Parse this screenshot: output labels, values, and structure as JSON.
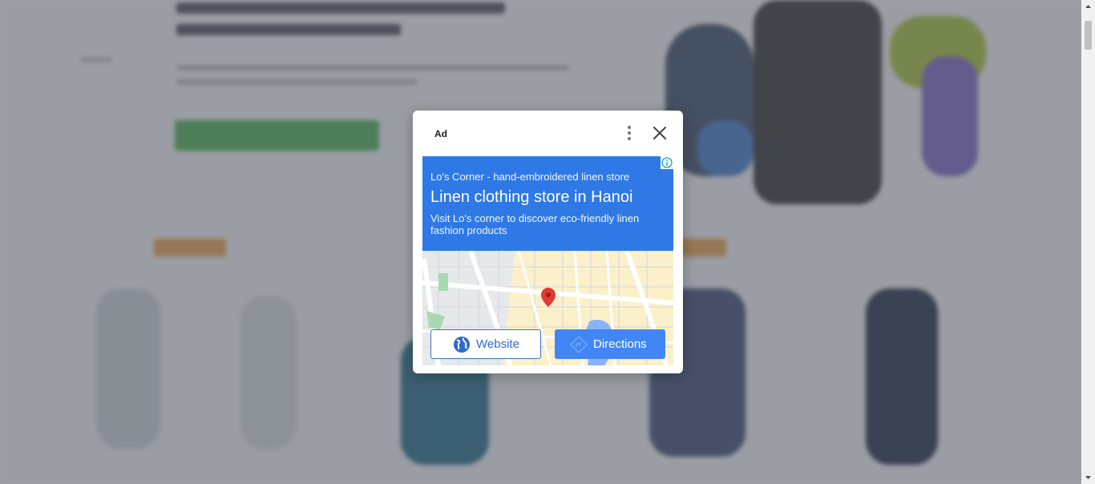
{
  "ad_dialog": {
    "ad_label": "Ad",
    "advertiser": "Lo's Corner - hand-embroidered linen store",
    "headline": "Linen clothing store in Hanoi",
    "description": "Visit Lo's corner to discover eco-friendly linen fashion products",
    "website_label": "Website",
    "directions_label": "Directions",
    "map_pin_color": "#e53935",
    "accent_color": "#2e79e6",
    "icons": [
      "kebab-menu-icon",
      "close-icon",
      "info-icon",
      "map-pin-icon",
      "globe-icon",
      "directions-icon"
    ]
  }
}
